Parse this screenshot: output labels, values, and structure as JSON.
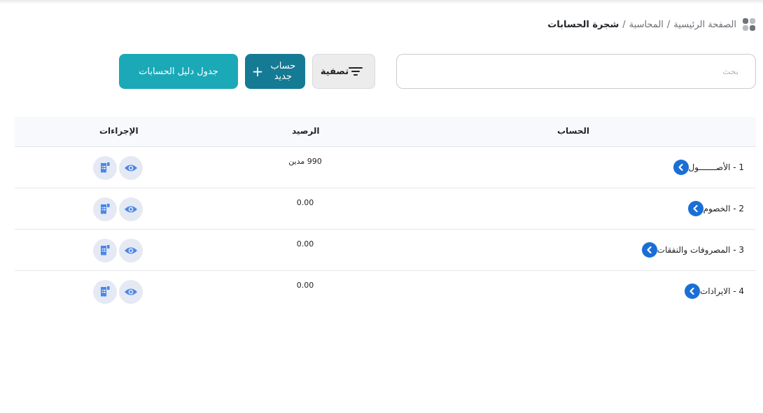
{
  "breadcrumb": {
    "home": "الصفحة الرئيسية",
    "section": "المحاسبة",
    "current": "شجرة الحسابات",
    "separator": "/"
  },
  "search": {
    "placeholder": "بحث",
    "value": ""
  },
  "toolbar": {
    "filter_label": "تصفية",
    "new_account_label": "حساب جديد",
    "chart_table_label": "جدول دليل الحسابات"
  },
  "table": {
    "headers": {
      "account": "الحساب",
      "balance": "الرصيد",
      "actions": "الإجراءات"
    },
    "rows": [
      {
        "account": "1 - الأصـــــــول",
        "balance": "990 مدين"
      },
      {
        "account": "2 - الخصوم",
        "balance": "0.00"
      },
      {
        "account": "3 - المصروفات والنفقات",
        "balance": "0.00"
      },
      {
        "account": "4 - الايرادات",
        "balance": "0.00"
      }
    ]
  },
  "icons": {
    "breadcrumb": "grid-icon",
    "filter": "filter-lines-icon",
    "new": "plus-icon",
    "expand": "chevron-left-icon",
    "view": "eye-icon",
    "statement": "receipt-icon"
  },
  "colors": {
    "primary": "#157a93",
    "accent": "#1ba9b7",
    "chevron": "#1a6fd6",
    "action_bg": "#e4e9f4",
    "action_icon": "#4a86e8"
  }
}
